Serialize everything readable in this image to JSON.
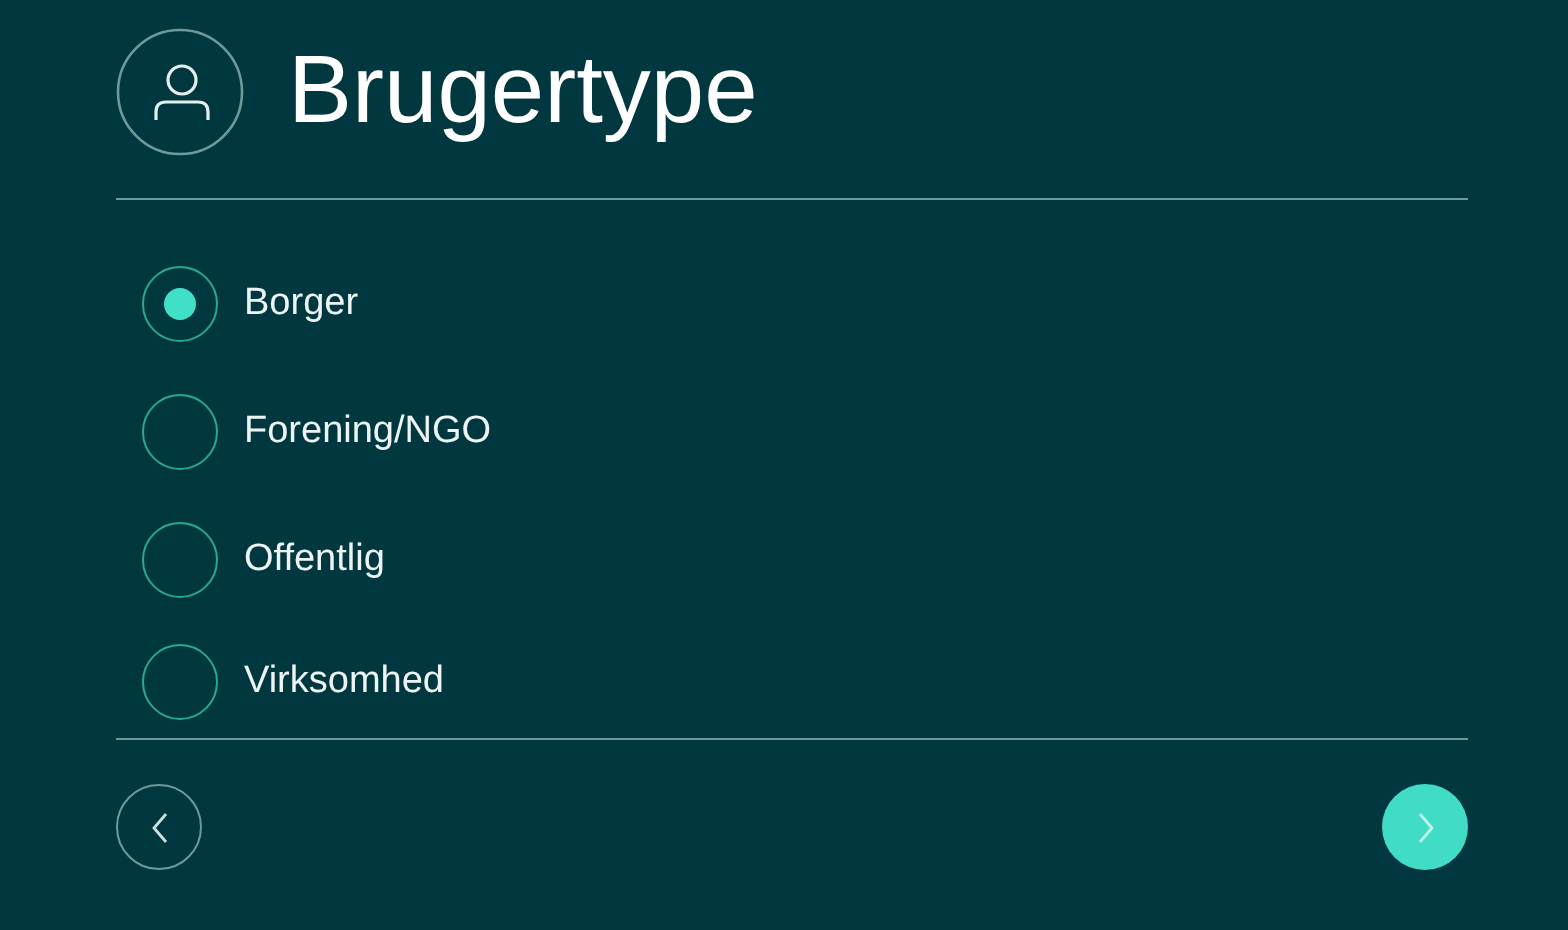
{
  "title": "Brugertype",
  "options": [
    {
      "label": "Borger",
      "selected": true
    },
    {
      "label": "Forening/NGO",
      "selected": false
    },
    {
      "label": "Offentlig",
      "selected": false
    },
    {
      "label": "Virksomhed",
      "selected": false
    }
  ]
}
